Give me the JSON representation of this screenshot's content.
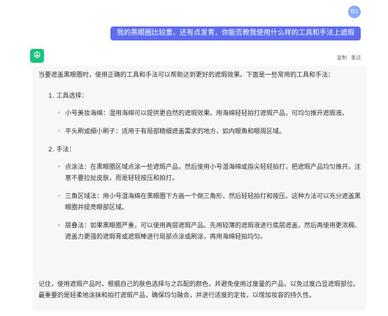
{
  "user": {
    "avatar_text": "f01",
    "question": "我的黑眼圈比较重，还有点发青，你能否教我使用什么样的工具和手法上遮瑕"
  },
  "assistant": {
    "avatar_icon": "chatgpt-logo-icon",
    "actions": {
      "copy": "复制",
      "retry": "重试"
    },
    "intro": "当要遮盖黑眼圈时，使用正确的工具和手法可以帮助达到更好的遮瑕效果。下面是一些常用的工具和手法：",
    "sections": [
      {
        "title": "1. 工具选择：",
        "items": [
          "小号美妆海绵：湿用海绵可以提供更自然的遮瑕效果。用海绵轻轻拍打遮瑕产品，可均匀推开遮瑕液。",
          "平头刷或细小刷子：适用于有局部精细遮盖需求的地方，如内眼角和眼周区域。"
        ]
      },
      {
        "title": "2. 手法：",
        "items": [
          "点涂法：在黑眼圈区域点涂一些遮瑕产品，然后使用小号湿海绵或指尖轻轻拍打，把遮瑕产品均匀推开。注意不要拉扯皮肤，而是轻轻按压和拍打。",
          "三角区域法：用小号湿海绵在黑眼圈下方画一个倒三角形，然后轻轻拍打和按压。这种方法可以充分遮盖黑眼圈并提亮眼部区域。",
          "层叠法：如果黑眼圈严重，可以使用两层遮瑕产品。先用较薄的遮瑕液进行底层遮盖，然后再使用更浓稠、遮盖力更强的遮瑕膏或遮瑕棒进行局部点涂或刷涂，再用海绵轻拍均匀。"
        ]
      }
    ],
    "closing": "记住，使用遮瑕产品时，根据自己的肤色选择与之匹配的颜色，并避免使用过度量的产品，以免过度凸显遮瑕部位。最重要的是轻柔地涂抹和拍打遮瑕产品，确保均匀融合，并进行适度的定妆，以增加妆容的持久性。"
  }
}
